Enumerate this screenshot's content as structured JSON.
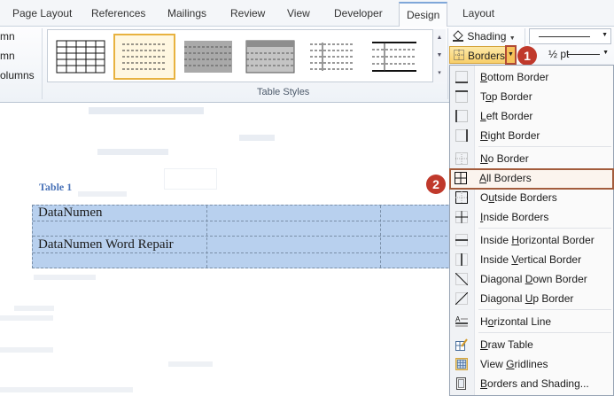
{
  "tabs": [
    {
      "label": "Page Layout"
    },
    {
      "label": "References"
    },
    {
      "label": "Mailings"
    },
    {
      "label": "Review"
    },
    {
      "label": "View"
    },
    {
      "label": "Developer"
    },
    {
      "label": "Design"
    },
    {
      "label": "Layout"
    }
  ],
  "ribbon": {
    "options": [
      "mn",
      "mn",
      "olumns"
    ],
    "table_styles_label": "Table Styles",
    "shading_label": "Shading",
    "borders_label": "Borders",
    "pen_weight": "½ pt"
  },
  "callouts": {
    "first": "1",
    "second": "2"
  },
  "document": {
    "caption": "Table 1",
    "rows": [
      "DataNumen",
      "DataNumen Word Repair"
    ]
  },
  "menu": {
    "items": [
      {
        "label": "Bottom Border",
        "icon": "bottom-border-icon"
      },
      {
        "label": "Top Border",
        "icon": "top-border-icon"
      },
      {
        "label": "Left Border",
        "icon": "left-border-icon"
      },
      {
        "label": "Right Border",
        "icon": "right-border-icon"
      },
      {
        "label": "No Border",
        "icon": "no-border-icon"
      },
      {
        "label": "All Borders",
        "icon": "all-borders-icon"
      },
      {
        "label": "Outside Borders",
        "icon": "outside-borders-icon"
      },
      {
        "label": "Inside Borders",
        "icon": "inside-borders-icon"
      },
      {
        "label": "Inside Horizontal Border",
        "icon": "inside-horizontal-border-icon"
      },
      {
        "label": "Inside Vertical Border",
        "icon": "inside-vertical-border-icon"
      },
      {
        "label": "Diagonal Down Border",
        "icon": "diagonal-down-border-icon"
      },
      {
        "label": "Diagonal Up Border",
        "icon": "diagonal-up-border-icon"
      },
      {
        "label": "Horizontal Line",
        "icon": "horizontal-line-icon"
      },
      {
        "label": "Draw Table",
        "icon": "draw-table-icon"
      },
      {
        "label": "View Gridlines",
        "icon": "view-gridlines-icon"
      },
      {
        "label": "Borders and Shading...",
        "icon": "borders-and-shading-icon"
      }
    ]
  },
  "colors": {
    "accent": "#7fa7d9",
    "highlight": "#a35c3c",
    "callout": "#c0392b",
    "table_fill": "#b8d0ee"
  }
}
